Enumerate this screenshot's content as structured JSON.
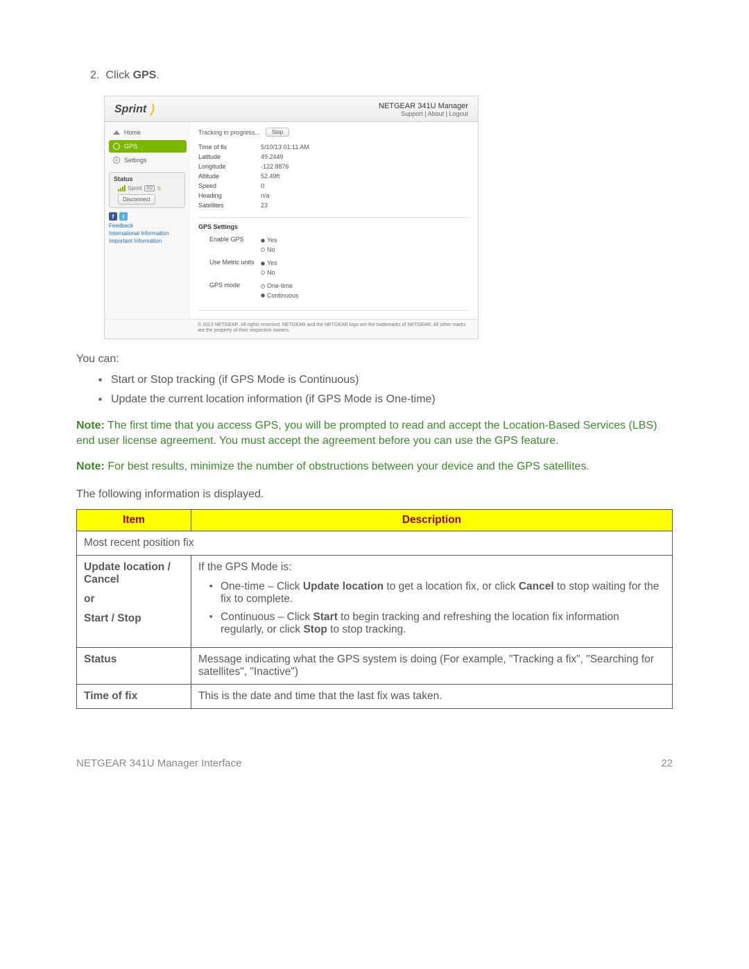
{
  "step": {
    "num": "2.",
    "pre": "Click ",
    "bold": "GPS",
    "post": "."
  },
  "screenshot": {
    "logo": "Sprint",
    "product": "NETGEAR 341U Manager",
    "headerLinks": {
      "support": "Support",
      "about": "About",
      "logout": "Logout"
    },
    "nav": {
      "home": "Home",
      "gps": "GPS",
      "settings": "Settings"
    },
    "status": {
      "title": "Status",
      "carrier": "Sprint",
      "badge": "3G",
      "disconnect": "Disconnect"
    },
    "sidebarLinks": {
      "feedback": "Feedback",
      "intl": "International Information",
      "important": "Important Information"
    },
    "tracking": {
      "label": "Tracking in progress...",
      "stop": "Stop"
    },
    "fields": {
      "timeOfFixLabel": "Time of fix",
      "timeOfFix": "5/10/13 01:11 AM",
      "latitudeLabel": "Latitude",
      "latitude": "49.2449",
      "longitudeLabel": "Longitude",
      "longitude": "-122.8876",
      "altitudeLabel": "Altitude",
      "altitude": "52.49ft",
      "speedLabel": "Speed",
      "speed": "0",
      "headingLabel": "Heading",
      "heading": "n/a",
      "satellitesLabel": "Satellites",
      "satellites": "23"
    },
    "settingsSection": {
      "title": "GPS Settings",
      "enableGpsLabel": "Enable GPS",
      "metricLabel": "Use Metric units",
      "modeLabel": "GPS mode",
      "yes": "Yes",
      "no": "No",
      "onetime": "One-time",
      "continuous": "Continuous"
    },
    "footer": "© 2013 NETGEAR. All rights reserved. NETGEAR and the NETGEAR logo are the trademarks of NETGEAR. All other marks are the property of their respective owners."
  },
  "youCan": "You can:",
  "bullets": [
    "Start or Stop tracking (if GPS Mode is Continuous)",
    "Update the current location information (if GPS Mode is One-time)"
  ],
  "note1": {
    "label": "Note:",
    "text": " The first time that you access GPS, you will be prompted to read and accept the Location-Based Services (LBS) end user license agreement. You must accept the agreement before you can use the GPS feature."
  },
  "note2": {
    "label": "Note:",
    "text": "  For best results, minimize the number of obstructions between your device and the GPS satellites."
  },
  "tableIntro": "The following information is displayed.",
  "table": {
    "head": {
      "item": "Item",
      "desc": "Description"
    },
    "sectionRow": "Most recent position fix",
    "r1": {
      "item1": "Update location / Cancel",
      "item2": "or",
      "item3": "Start / Stop",
      "descIntro": "If the GPS Mode is:",
      "b1a": "One-time – Click ",
      "b1b": "Update location",
      "b1c": " to get a location fix, or click ",
      "b1d": "Cancel",
      "b1e": " to stop waiting for the fix to complete.",
      "b2a": "Continuous – Click ",
      "b2b": "Start",
      "b2c": " to begin tracking and refreshing the location fix information regularly, or click ",
      "b2d": "Stop",
      "b2e": " to stop tracking."
    },
    "r2": {
      "item": "Status",
      "desc": "Message indicating what the GPS system is doing (For example, \"Tracking a fix\", \"Searching for satellites\", \"Inactive\")"
    },
    "r3": {
      "item": "Time of fix",
      "desc": "This is the date and time that the last fix was taken."
    }
  },
  "footer": {
    "left": "NETGEAR 341U Manager Interface",
    "right": "22"
  }
}
